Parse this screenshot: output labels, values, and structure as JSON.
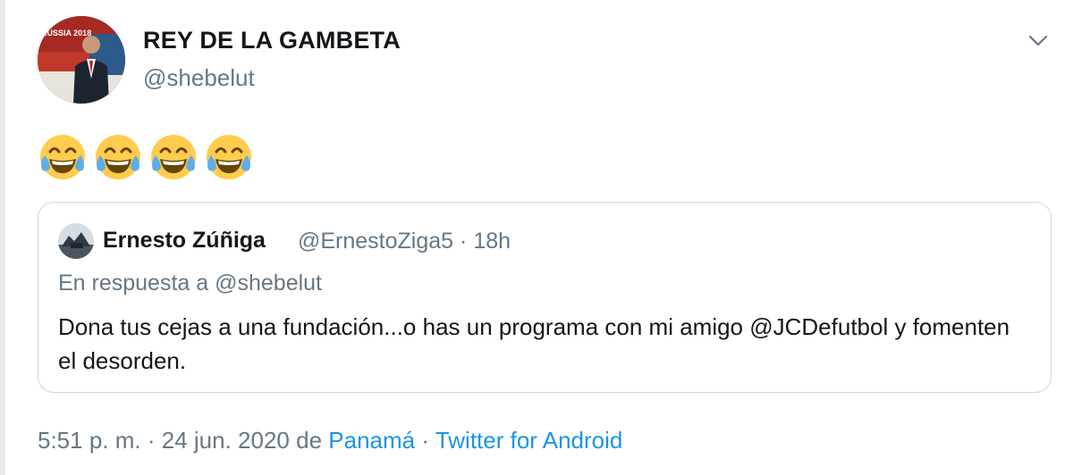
{
  "author": {
    "display_name": "REY DE LA GAMBETA",
    "handle": "@shebelut",
    "avatar_text": "RUSSIA 2018"
  },
  "tweet": {
    "emojis": [
      "😂",
      "😂",
      "😂",
      "😂"
    ]
  },
  "quoted_tweet": {
    "author_name": "Ernesto Zúñiga",
    "author_handle": "@ErnestoZiga5",
    "separator": "·",
    "time_ago": "18h",
    "reply_to": "En respuesta a @shebelut",
    "text": "Dona tus cejas a una fundación...o has un programa con mi amigo @JCDefutbol y fomenten el desorden."
  },
  "footer": {
    "time": "5:51 p. m.",
    "sep1": "·",
    "date": "24 jun. 2020",
    "de": "de",
    "location": "Panamá",
    "sep2": "·",
    "source": "Twitter for Android"
  },
  "colors": {
    "text_primary": "#14171a",
    "text_secondary": "#657786",
    "link": "#1b95e0",
    "border": "#ccd6dd"
  },
  "icons": {
    "caret": "chevron-down-icon"
  }
}
